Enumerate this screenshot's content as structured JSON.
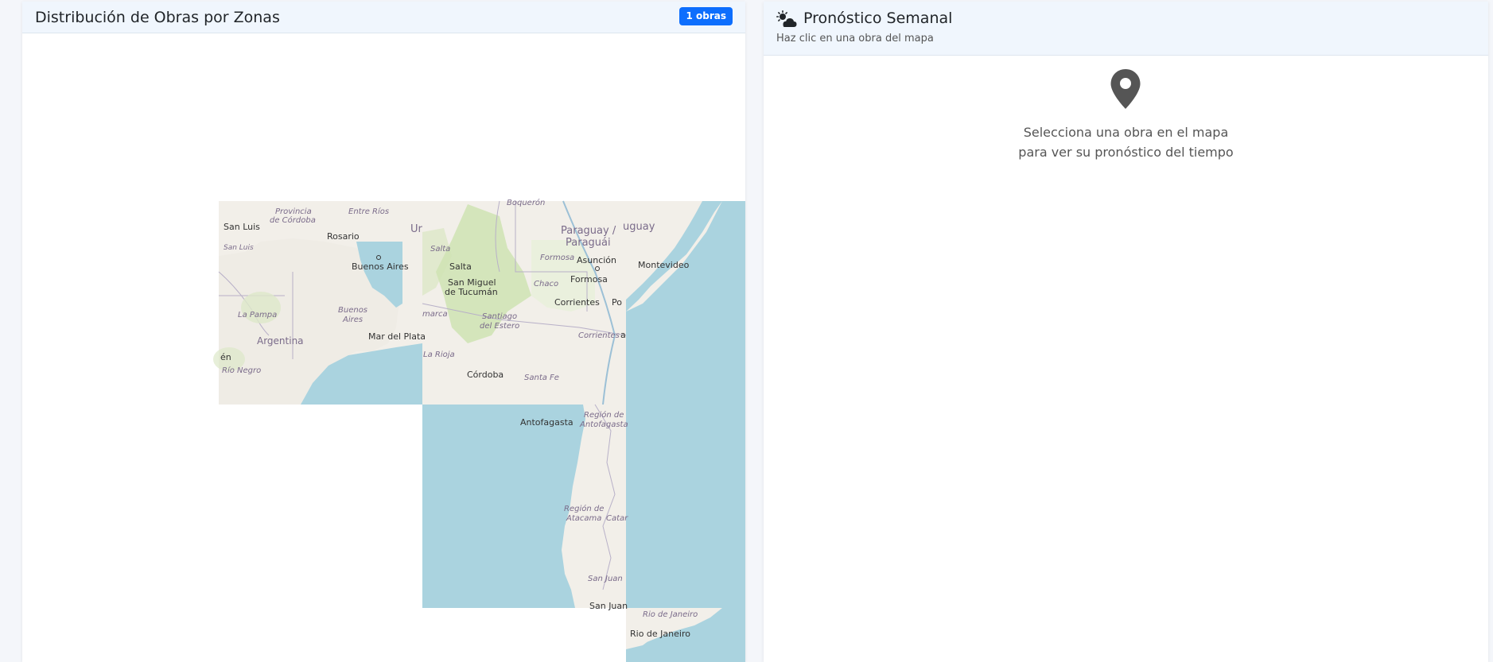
{
  "map_panel": {
    "title": "Distribución de Obras por Zonas",
    "badge": "1 obras",
    "labels": {
      "san_luis": "San Luis",
      "provincia_cordoba_1": "Provincia",
      "provincia_cordoba_2": "de Córdoba",
      "entre_rios": "Entre Ríos",
      "rosario": "Rosario",
      "ur": "Ur",
      "san_luis_prov": "San Luis",
      "buenos_aires_city": "Buenos Aires",
      "buenos_aires_prov_1": "Buenos",
      "buenos_aires_prov_2": "Aires",
      "la_pampa": "La Pampa",
      "argentina": "Argentina",
      "mar_del_plata": "Mar del Plata",
      "en": "én",
      "rio_negro": "Río Negro",
      "boqueron": "Boquerón",
      "uguay": "uguay",
      "paraguay_1": "Paraguay /",
      "paraguay_2": "Paraguái",
      "salta_prov": "Salta",
      "salta": "Salta",
      "formosa_prov": "Formosa",
      "asuncion": "Asunción",
      "montevideo": "Montevideo",
      "san_miguel_1": "San Miguel",
      "san_miguel_2": "de Tucumán",
      "chaco": "Chaco",
      "formosa": "Formosa",
      "corrientes": "Corrientes",
      "po": "Po",
      "marca": "marca",
      "santiago_1": "Santiago",
      "santiago_2": "del Estero",
      "corrientes_prov": "Corrientes",
      "a": "a",
      "la_rioja": "La Rioja",
      "cordoba": "Córdoba",
      "santa_fe": "Santa Fe",
      "antofagasta": "Antofagasta",
      "region_antofagasta_1": "Región de",
      "region_antofagasta_2": "Antofagasta",
      "region_atacama_1": "Región de",
      "region_atacama_2": "Atacama",
      "catar": "Catar",
      "san_juan_prov": "San Juan",
      "san_juan": "San Juan",
      "rio_janeiro_state": "Rio de Janeiro",
      "rio_janeiro": "Rio de Janeiro"
    }
  },
  "forecast_panel": {
    "title": "Pronóstico Semanal",
    "subtitle": "Haz clic en una obra del mapa",
    "empty_line1": "Selecciona una obra en el mapa",
    "empty_line2": "para ver su pronóstico del tiempo"
  },
  "colors": {
    "land": "#f2efe9",
    "water": "#aad3df",
    "vegetation": "#cfe3b3",
    "accent": "#0d6efd",
    "header_bg": "#f0f6fd"
  },
  "icons": {
    "weather": "cloud-sun-icon",
    "location": "map-pin-icon"
  }
}
